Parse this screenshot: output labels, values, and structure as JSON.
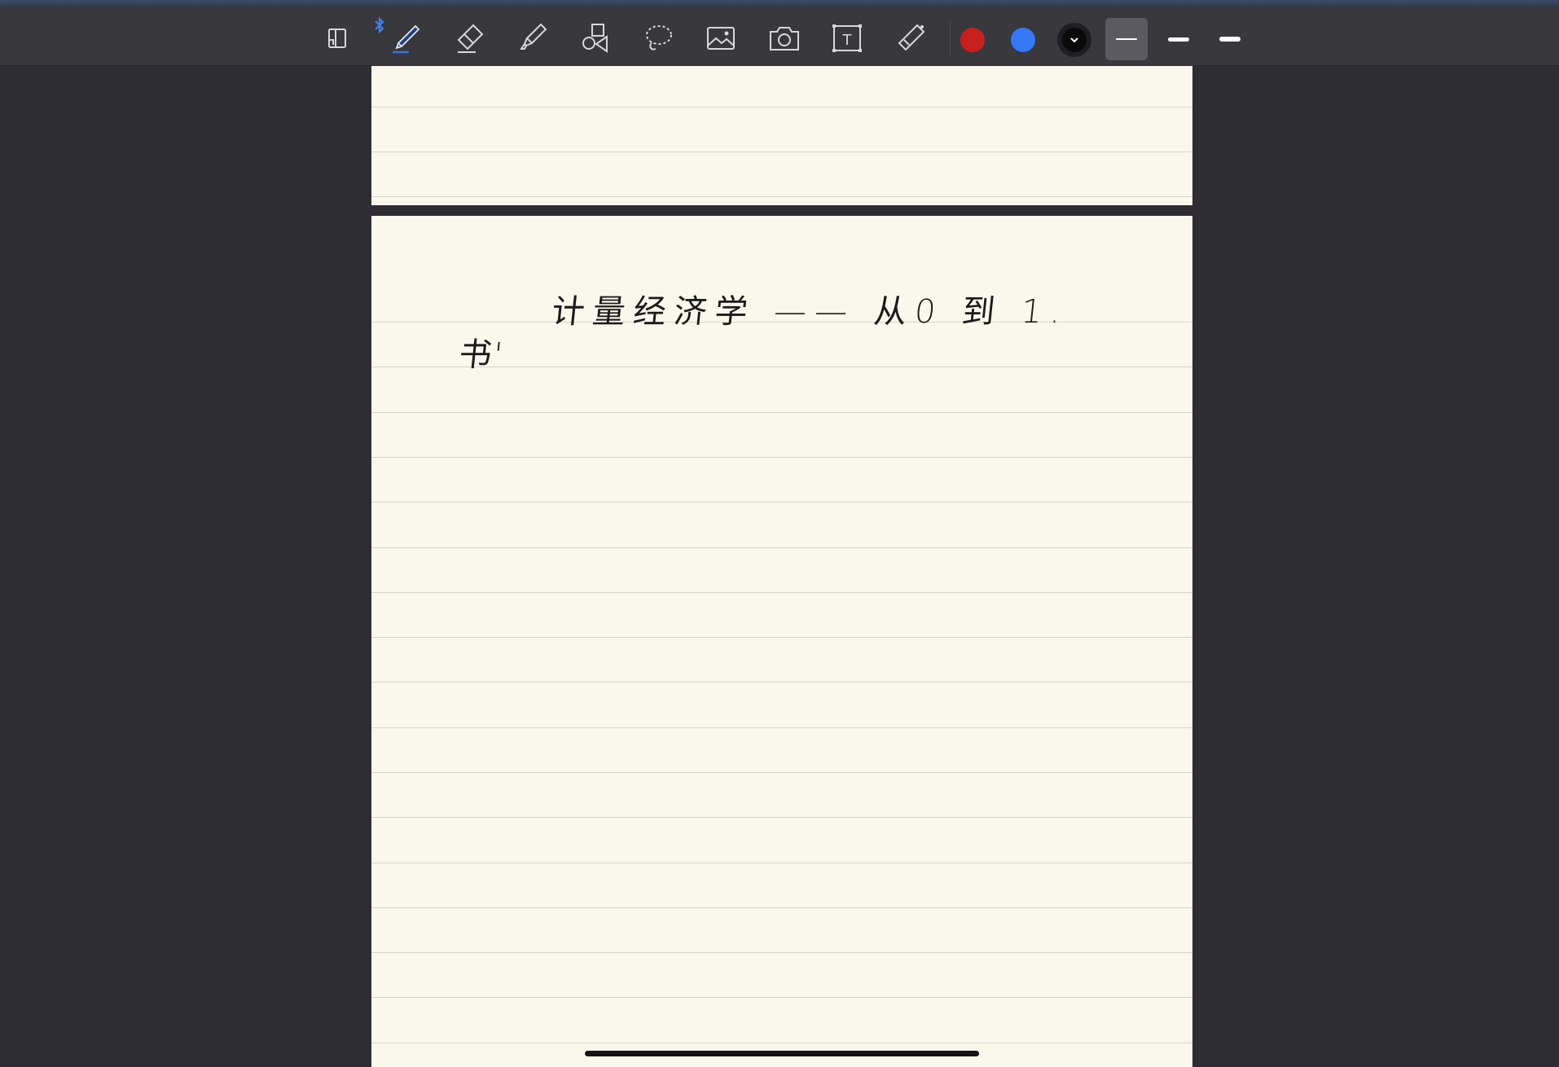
{
  "toolbar": {
    "tools": [
      {
        "name": "page-view-icon",
        "label": "Pages"
      },
      {
        "name": "pen-icon",
        "label": "Pen",
        "active": true
      },
      {
        "name": "eraser-icon",
        "label": "Eraser"
      },
      {
        "name": "highlighter-icon",
        "label": "Highlighter"
      },
      {
        "name": "shapes-icon",
        "label": "Shapes"
      },
      {
        "name": "lasso-icon",
        "label": "Lasso"
      },
      {
        "name": "image-icon",
        "label": "Image"
      },
      {
        "name": "camera-icon",
        "label": "Camera"
      },
      {
        "name": "text-icon",
        "label": "Text",
        "glyph": "T"
      },
      {
        "name": "laser-pointer-icon",
        "label": "Laser pointer"
      }
    ],
    "bluetooth_icon": "bluetooth-icon",
    "colors": [
      {
        "name": "red",
        "hex": "#c8201e"
      },
      {
        "name": "blue",
        "hex": "#3578f6"
      },
      {
        "name": "black",
        "hex": "#0b0b0b",
        "selected": true
      }
    ],
    "stroke_sizes": [
      "thin",
      "medium",
      "thick"
    ],
    "active_stroke": "thin"
  },
  "notebook": {
    "paper_color": "#f8f8ec",
    "line_color": "#d3d5cc",
    "handwriting": {
      "title": "计量经济学 —— 从0 到 1.",
      "note": "书'"
    }
  }
}
